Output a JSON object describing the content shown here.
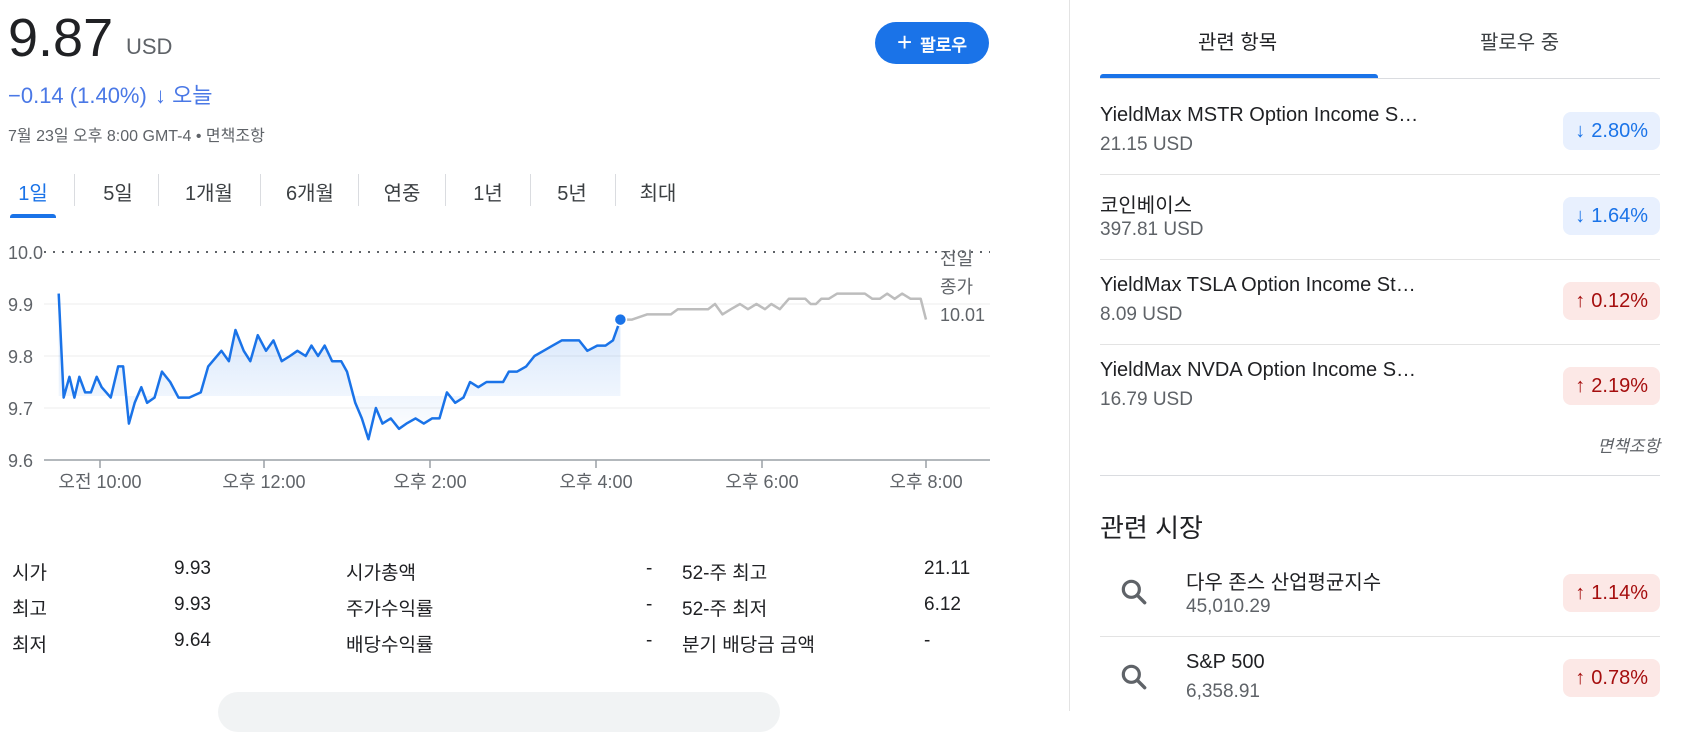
{
  "quote": {
    "price": "9.87",
    "currency": "USD",
    "change_text": "−0.14 (1.40%)",
    "change_arrow": "↓",
    "change_period": "오늘",
    "datetime": "7월 23일 오후 8:00 GMT-4",
    "datetime_sep": "•",
    "disclaimer": "면책조항",
    "follow_label": "팔로우",
    "colors": {
      "up": "#a50e0e",
      "down": "#1a73e8",
      "accent": "#1a73e8"
    }
  },
  "tabs": [
    "1일",
    "5일",
    "1개월",
    "6개월",
    "연중",
    "1년",
    "5년",
    "최대"
  ],
  "active_tab": "1일",
  "chart_data": {
    "type": "line",
    "y_ticks": [
      "10.0",
      "9.9",
      "9.8",
      "9.7",
      "9.6"
    ],
    "ylim": [
      9.6,
      10.0
    ],
    "x_ticks": [
      "오전 10:00",
      "오후 12:00",
      "오후 2:00",
      "오후 4:00",
      "오후 6:00",
      "오후 8:00"
    ],
    "x_tick_hours": [
      10,
      12,
      14,
      16,
      18,
      20
    ],
    "xlim": [
      9.5,
      20.0
    ],
    "previous_close_label": [
      "전일",
      "종가"
    ],
    "previous_close": "10.01",
    "regular": {
      "color": "#1a73e8",
      "points": [
        [
          9.5,
          9.92
        ],
        [
          9.56,
          9.72
        ],
        [
          9.63,
          9.76
        ],
        [
          9.69,
          9.72
        ],
        [
          9.75,
          9.76
        ],
        [
          9.82,
          9.73
        ],
        [
          9.89,
          9.73
        ],
        [
          9.96,
          9.76
        ],
        [
          10.02,
          9.74
        ],
        [
          10.13,
          9.72
        ],
        [
          10.22,
          9.78
        ],
        [
          10.28,
          9.78
        ],
        [
          10.35,
          9.67
        ],
        [
          10.42,
          9.71
        ],
        [
          10.5,
          9.74
        ],
        [
          10.57,
          9.71
        ],
        [
          10.66,
          9.72
        ],
        [
          10.75,
          9.77
        ],
        [
          10.85,
          9.75
        ],
        [
          10.95,
          9.72
        ],
        [
          11.08,
          9.72
        ],
        [
          11.22,
          9.73
        ],
        [
          11.31,
          9.78
        ],
        [
          11.47,
          9.81
        ],
        [
          11.56,
          9.79
        ],
        [
          11.64,
          9.85
        ],
        [
          11.74,
          9.81
        ],
        [
          11.82,
          9.79
        ],
        [
          11.91,
          9.84
        ],
        [
          12.01,
          9.81
        ],
        [
          12.1,
          9.83
        ],
        [
          12.2,
          9.79
        ],
        [
          12.3,
          9.8
        ],
        [
          12.39,
          9.81
        ],
        [
          12.49,
          9.8
        ],
        [
          12.56,
          9.82
        ],
        [
          12.64,
          9.8
        ],
        [
          12.72,
          9.82
        ],
        [
          12.81,
          9.79
        ],
        [
          12.92,
          9.79
        ],
        [
          12.99,
          9.77
        ],
        [
          13.09,
          9.71
        ],
        [
          13.17,
          9.68
        ],
        [
          13.25,
          9.64
        ],
        [
          13.34,
          9.7
        ],
        [
          13.42,
          9.67
        ],
        [
          13.52,
          9.68
        ],
        [
          13.62,
          9.66
        ],
        [
          13.71,
          9.67
        ],
        [
          13.82,
          9.68
        ],
        [
          13.92,
          9.67
        ],
        [
          14.02,
          9.68
        ],
        [
          14.11,
          9.68
        ],
        [
          14.2,
          9.73
        ],
        [
          14.3,
          9.71
        ],
        [
          14.4,
          9.72
        ],
        [
          14.48,
          9.75
        ],
        [
          14.58,
          9.74
        ],
        [
          14.68,
          9.75
        ],
        [
          14.79,
          9.75
        ],
        [
          14.88,
          9.75
        ],
        [
          14.95,
          9.77
        ],
        [
          15.05,
          9.77
        ],
        [
          15.16,
          9.78
        ],
        [
          15.26,
          9.8
        ],
        [
          15.37,
          9.81
        ],
        [
          15.48,
          9.82
        ],
        [
          15.59,
          9.83
        ],
        [
          15.7,
          9.83
        ],
        [
          15.8,
          9.83
        ],
        [
          15.9,
          9.81
        ],
        [
          16.02,
          9.82
        ],
        [
          16.12,
          9.82
        ],
        [
          16.21,
          9.83
        ],
        [
          16.3,
          9.87
        ]
      ],
      "marker": [
        16.3,
        9.87
      ]
    },
    "extended": {
      "color": "#bdbdbd",
      "points": [
        [
          16.3,
          9.87
        ],
        [
          16.52,
          9.87
        ],
        [
          16.8,
          9.88
        ],
        [
          17.25,
          9.88
        ],
        [
          17.38,
          9.89
        ],
        [
          17.65,
          9.89
        ],
        [
          17.95,
          9.89
        ],
        [
          18.08,
          9.9
        ],
        [
          18.22,
          9.88
        ],
        [
          18.38,
          9.89
        ],
        [
          18.55,
          9.9
        ],
        [
          18.7,
          9.89
        ],
        [
          18.86,
          9.9
        ],
        [
          19.02,
          9.89
        ],
        [
          19.14,
          9.9
        ],
        [
          19.3,
          9.89
        ],
        [
          19.47,
          9.91
        ],
        [
          19.62,
          9.91
        ],
        [
          19.78,
          9.91
        ],
        [
          19.88,
          9.9
        ],
        [
          19.98,
          9.9
        ],
        [
          20.08,
          9.91
        ],
        [
          20.22,
          9.91
        ],
        [
          20.38,
          9.92
        ],
        [
          20.55,
          9.92
        ],
        [
          20.76,
          9.92
        ],
        [
          20.9,
          9.92
        ],
        [
          21.04,
          9.91
        ],
        [
          21.18,
          9.91
        ],
        [
          21.32,
          9.92
        ],
        [
          21.46,
          9.91
        ],
        [
          21.6,
          9.92
        ],
        [
          21.76,
          9.91
        ],
        [
          21.95,
          9.91
        ],
        [
          22.05,
          9.87
        ]
      ]
    },
    "grid": true
  },
  "stats": {
    "col1": [
      {
        "label": "시가",
        "value": "9.93"
      },
      {
        "label": "최고",
        "value": "9.93"
      },
      {
        "label": "최저",
        "value": "9.64"
      }
    ],
    "col2": [
      {
        "label": "시가총액",
        "value": "-"
      },
      {
        "label": "주가수익률",
        "value": "-"
      },
      {
        "label": "배당수익률",
        "value": "-"
      }
    ],
    "col3": [
      {
        "label": "52-주 최고",
        "value": "21.11"
      },
      {
        "label": "52-주 최저",
        "value": "6.12"
      },
      {
        "label": "분기 배당금 금액",
        "value": "-"
      }
    ]
  },
  "right_tabs": [
    "관련 항목",
    "팔로우 중"
  ],
  "right_active_tab": "관련 항목",
  "related_items": [
    {
      "name": "YieldMax MSTR Option Income S…",
      "price": "21.15 USD",
      "direction": "down",
      "arrow": "↓",
      "change": "2.80%"
    },
    {
      "name": "코인베이스",
      "price": "397.81 USD",
      "direction": "down",
      "arrow": "↓",
      "change": "1.64%"
    },
    {
      "name": "YieldMax TSLA Option Income St…",
      "price": "8.09 USD",
      "direction": "up",
      "arrow": "↑",
      "change": "0.12%"
    },
    {
      "name": "YieldMax NVDA Option Income S…",
      "price": "16.79 USD",
      "direction": "up",
      "arrow": "↑",
      "change": "2.19%"
    }
  ],
  "related_disclaimer": "면책조항",
  "markets_title": "관련 시장",
  "markets": [
    {
      "icon": "search-icon",
      "name": "다우 존스 산업평균지수",
      "value": "45,010.29",
      "direction": "up",
      "arrow": "↑",
      "change": "1.14%"
    },
    {
      "icon": "search-icon",
      "name": "S&P 500",
      "value": "6,358.91",
      "direction": "up",
      "arrow": "↑",
      "change": "0.78%"
    }
  ]
}
